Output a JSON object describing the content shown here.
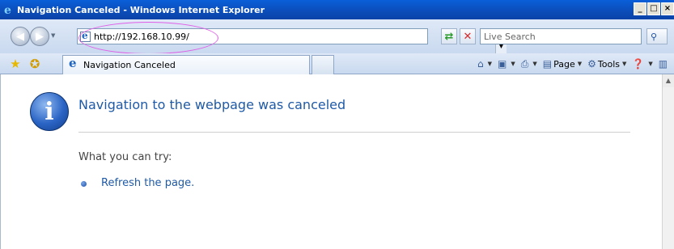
{
  "window": {
    "title": "Navigation Canceled - Windows Internet Explorer",
    "controls": {
      "minimize": "_",
      "maximize": "□",
      "close": "×"
    }
  },
  "addressbar": {
    "url": "http://192.168.10.99/",
    "search_placeholder": "Live Search"
  },
  "tabs": [
    {
      "label": "Navigation Canceled",
      "active": true
    }
  ],
  "commandbar": {
    "page_label": "Page",
    "tools_label": "Tools"
  },
  "content": {
    "heading": "Navigation to the webpage was canceled",
    "try_label": "What you can try:",
    "refresh_link": "Refresh the page."
  },
  "colors": {
    "titlebar": "#0b4cb8",
    "link": "#1f5aa6",
    "highlight": "#e060e8"
  },
  "icons": {
    "info": "info-icon",
    "refresh": "refresh-icon",
    "stop": "stop-icon",
    "search": "search-icon"
  }
}
